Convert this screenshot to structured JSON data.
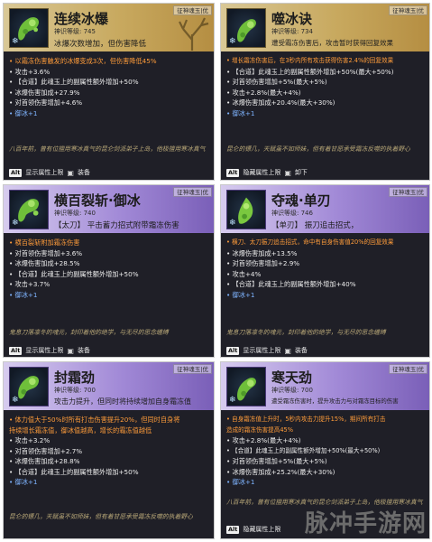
{
  "colors": {
    "panel": "#1f1f27",
    "gold_header": "#c8a95f",
    "purple_header": "#a28ad7",
    "orange_text": "#ff9c3a",
    "blue_text": "#7fb4ff",
    "flavor_text": "#b9a878"
  },
  "cards": [
    {
      "tag": "征神魂玉|优",
      "title": "连续冰爆",
      "level": "神识等级: 745",
      "desc": "冰爆次数增加，但伤害降低",
      "lines": [
        {
          "t": "• 以霜冻伤害触发的冰爆变成3次，但伤害降低45%",
          "c": "orange"
        },
        {
          "t": "• 攻击+3.6%"
        },
        {
          "t": "• 【合道】此魂玉上的副属性额外增加+50%"
        },
        {
          "t": "• 冰爆伤害加成+27.9%"
        },
        {
          "t": "• 对首领伤害增加+4.6%"
        },
        {
          "t": "• 御冰+1",
          "c": "blue"
        }
      ],
      "flavor": "八百年前，曾有位擅用寒冰真气的昆仑剑派弟子上岛，他极擅用寒冰真气",
      "footer_key": "Alt",
      "footer_text": "显示属性上限",
      "footer_equip": "装备"
    },
    {
      "tag": "征神魂玉|优",
      "title": "噬冰诀",
      "level": "神识等级: 734",
      "desc": "遭受霜冻伤害后，攻击暂时获得回复效果",
      "lines": [
        {
          "t": "• 增长霜冻伤害后，在3秒内所有攻击获得伤害2.4%的回复效果",
          "c": "orange"
        },
        {
          "t": "• 【合道】此魂玉上的副属性额外增加+50%(最大+50%)"
        },
        {
          "t": "• 对首领伤害增加+5%(最大+5%)"
        },
        {
          "t": "• 攻击+2.8%(最大+4%)"
        },
        {
          "t": "• 冰爆伤害加成+20.4%(最大+30%)"
        },
        {
          "t": "• 御冰+1",
          "c": "blue"
        }
      ],
      "flavor": "昆仑的镖几，天赋虽不如师妹，但有着甘愿承受霜冻反噬的执着野心",
      "footer_key": "Alt",
      "footer_text": "隐藏属性上限",
      "footer_equip": "卸下"
    },
    {
      "tag": "征神魂玉|优",
      "title": "横百裂斩·御冰",
      "level": "神识等级: 740",
      "desc": "【太刀】 平击蓄力招式附带霜冻伤害",
      "lines": [
        {
          "t": "• 横百裂斩附加霜冻伤害",
          "c": "orange"
        },
        {
          "t": "• 对首领伤害增加+3.6%"
        },
        {
          "t": "• 冰爆伤害加成+28.5%"
        },
        {
          "t": "• 【合道】此魂玉上的副属性额外增加+50%"
        },
        {
          "t": "• 攻击+3.7%"
        },
        {
          "t": "• 御冰+1",
          "c": "blue"
        }
      ],
      "flavor": "鬼息刀落凛冬的魂元，封印着他的绝学，与无尽的思念缠缚",
      "footer_key": "Alt",
      "footer_text": "显示属性上限",
      "footer_equip": "装备"
    },
    {
      "tag": "征神魂玉|优",
      "title": "夺魂·单刃",
      "level": "神识等级: 746",
      "desc": "【单刃】 振刀追击招式，",
      "lines": [
        {
          "t": "• 横刀、太刀振刀追击招式，命中有自身伤害值20%的回复效果",
          "c": "orange"
        },
        {
          "t": "• 冰爆伤害加成+13.5%"
        },
        {
          "t": "• 对首领伤害增加+2.9%"
        },
        {
          "t": "• 攻击+4%"
        },
        {
          "t": "• 【合道】此魂玉上的副属性额外增加+40%"
        },
        {
          "t": "• 御冰+1",
          "c": "blue"
        }
      ],
      "flavor": "鬼息刀落凛冬的魂元，封印着他的绝学，与无尽的思念缠缚",
      "footer_key": "Alt",
      "footer_text": "显示属性上限",
      "footer_equip": "装备"
    },
    {
      "tag": "征神魂玉|优",
      "title": "封霜劲",
      "level": "神识等级: 700",
      "desc": "攻击力提升，但同时将持续增加自身霜冻值",
      "lines": [
        {
          "t": "• 体力值大于50%时所有打击伤害提升20%，但同时自身将",
          "c": "orange"
        },
        {
          "t": "  持续增长霜冻值，御冰值越高，增长的霜冻值越低",
          "c": "orange"
        },
        {
          "t": "• 攻击+3.2%"
        },
        {
          "t": "• 对首领伤害增加+2.7%"
        },
        {
          "t": "• 冰爆伤害加成+28.8%"
        },
        {
          "t": "• 【合道】此魂玉上的副属性额外增加+50%"
        },
        {
          "t": "• 御冰+1",
          "c": "blue"
        }
      ],
      "flavor": "昆仑的镖几，天赋虽不如师妹，但有着甘愿承受霜冻反噬的执着野心",
      "footer_key": "Alt",
      "footer_text": "显示属性上限",
      "footer_equip": "装备"
    },
    {
      "tag": "征神魂玉|优",
      "title": "寒天劲",
      "level": "神识等级: 700",
      "desc": "遭受霜冻伤害时，提升攻击力与对霜冻目标的伤害",
      "lines": [
        {
          "t": "• 自身霜冻值上升时，5秒内攻击力提升15%，期间所有打击",
          "c": "orange"
        },
        {
          "t": "  造成的霜冻伤害提高45%",
          "c": "orange"
        },
        {
          "t": "• 攻击+2.8%(最大+4%)"
        },
        {
          "t": "• 【合道】此魂玉上的副属性额外增加+50%(最大+50%)"
        },
        {
          "t": "• 对首领伤害增加+5%(最大+5%)"
        },
        {
          "t": "• 冰爆伤害加成+25.2%(最大+30%)"
        },
        {
          "t": "• 御冰+1",
          "c": "blue"
        }
      ],
      "flavor": "八百年前，曾有位擅用寒冰真气的昆仑剑派弟子上岛，他极擅用寒冰真气",
      "footer_key": "Alt",
      "footer_text": "隐藏属性上限",
      "footer_equip": ""
    }
  ],
  "watermark": "脉冲手游网"
}
